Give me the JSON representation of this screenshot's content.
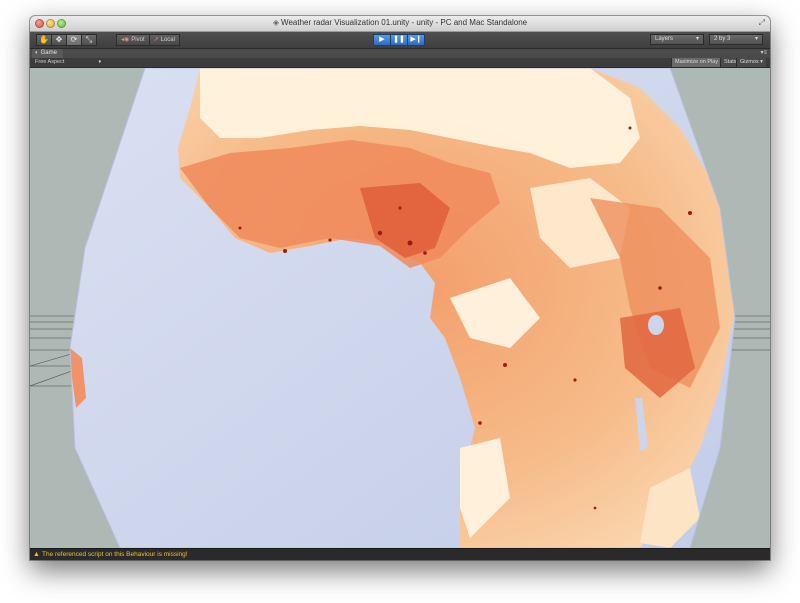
{
  "window": {
    "title": "Weather radar Visualization 01.unity - unity - PC and Mac Standalone"
  },
  "toolbar": {
    "tools": [
      "hand-tool",
      "move-tool",
      "rotate-tool",
      "scale-tool"
    ],
    "pivot_label": "Pivot",
    "local_label": "Local",
    "play_controls": [
      "play",
      "pause",
      "step"
    ],
    "layers_label": "Layers",
    "layout_label": "2 by 3"
  },
  "tab": {
    "label": "Game"
  },
  "gamebar": {
    "aspect_label": "Free Aspect",
    "maximize_label": "Maximize on Play",
    "stats_label": "Stats",
    "gizmos_label": "Gizmos"
  },
  "status": {
    "message": "The referenced script on this Behaviour is missing!"
  },
  "colors": {
    "ocean": "#ccd5ec",
    "land_light": "#fff3de",
    "land_mid": "#f5b07a",
    "land_dark": "#d8452a",
    "hot_spot": "#9e1a1a",
    "viewport_bg": "#aeb8b5",
    "accent_play": "#3b7fd1",
    "warning": "#e8c338"
  }
}
